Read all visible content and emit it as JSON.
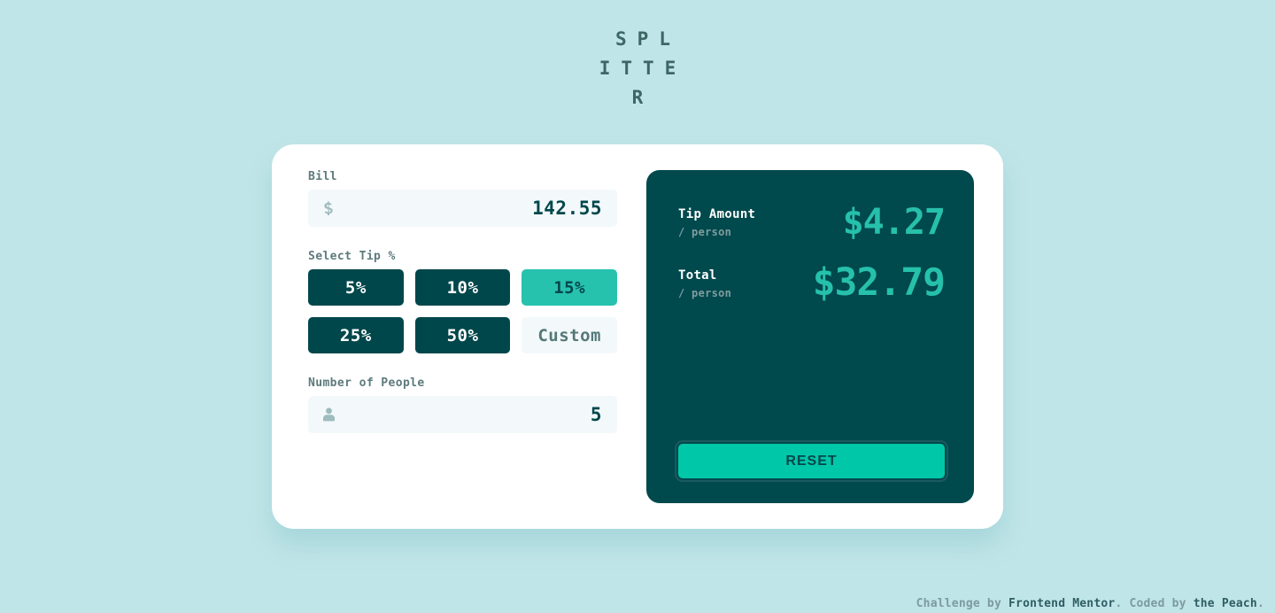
{
  "app": {
    "title": "SPLITTER"
  },
  "form": {
    "bill": {
      "label": "Bill",
      "icon": "dollar-icon",
      "value": "142.55"
    },
    "tip": {
      "label": "Select Tip %",
      "options": [
        {
          "label": "5%",
          "active": false
        },
        {
          "label": "10%",
          "active": false
        },
        {
          "label": "15%",
          "active": true
        },
        {
          "label": "25%",
          "active": false
        },
        {
          "label": "50%",
          "active": false
        },
        {
          "label": "Custom",
          "active": false
        }
      ]
    },
    "people": {
      "label": "Number of People",
      "icon": "person-icon",
      "value": "5"
    }
  },
  "results": {
    "tip": {
      "title": "Tip Amount",
      "sub": "/ person",
      "amount": "$4.27"
    },
    "total": {
      "title": "Total",
      "sub": "/ person",
      "amount": "$32.79"
    },
    "reset_label": "RESET"
  },
  "footer": {
    "part1": "Challenge by ",
    "brand1": "Frontend Mentor",
    "part2": ". Coded by ",
    "brand2": "the Peach",
    "part3": "."
  },
  "colors": {
    "page_bg": "#C0E5E8",
    "card_bg": "#FFFFFF",
    "dark_panel": "#00494D",
    "accent": "#26C2AE",
    "accent_strong": "#00C7A8",
    "amount": "#26C0AB",
    "label": "#5E7A7D",
    "input_bg": "#F3F8FB",
    "muted": "#7F9D9F"
  }
}
